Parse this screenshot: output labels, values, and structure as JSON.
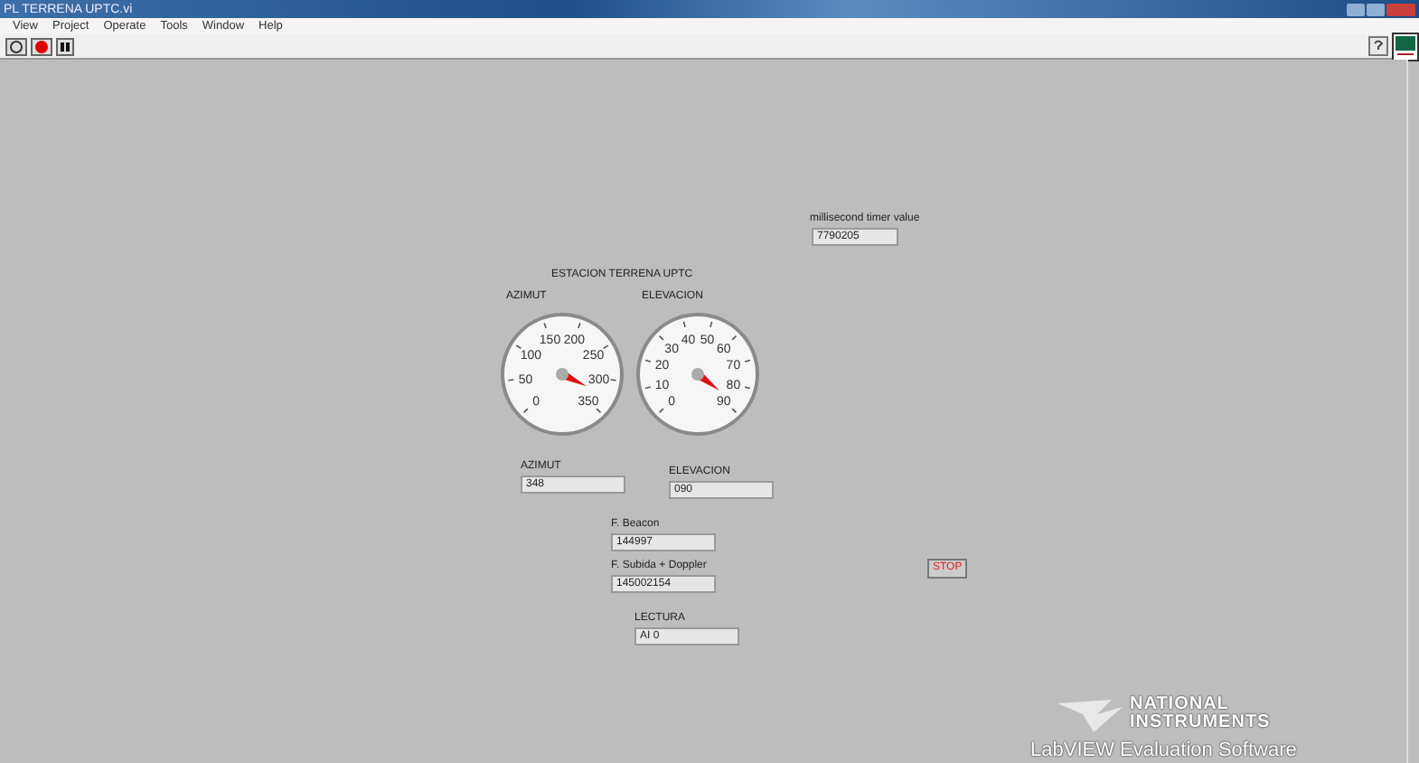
{
  "window": {
    "title": "PL TERRENA UPTC.vi"
  },
  "menu": [
    "View",
    "Project",
    "Operate",
    "Tools",
    "Window",
    "Help"
  ],
  "panel": {
    "timer": {
      "label": "millisecond timer value",
      "value": "7790205"
    },
    "heading": "ESTACION TERRENA UPTC",
    "gauges": [
      {
        "label": "AZIMUT",
        "ticks": [
          "0",
          "50",
          "100",
          "150",
          "200",
          "250",
          "300",
          "350"
        ]
      },
      {
        "label": "ELEVACION",
        "ticks": [
          "0",
          "10",
          "20",
          "30",
          "40",
          "50",
          "60",
          "70",
          "80",
          "90"
        ]
      }
    ],
    "indicators": [
      {
        "label": "AZIMUT",
        "value": "348"
      },
      {
        "label": "ELEVACION",
        "value": "090"
      },
      {
        "label": "F. Beacon",
        "value": "144997"
      },
      {
        "label": "F. Subida + Doppler",
        "value": "145002154"
      },
      {
        "label": "LECTURA",
        "value": "AI 0"
      }
    ],
    "stop": "STOP",
    "brand": {
      "name1": "NATIONAL",
      "name2": "INSTRUMENTS",
      "tagline": "LabVIEW Evaluation Software"
    }
  }
}
